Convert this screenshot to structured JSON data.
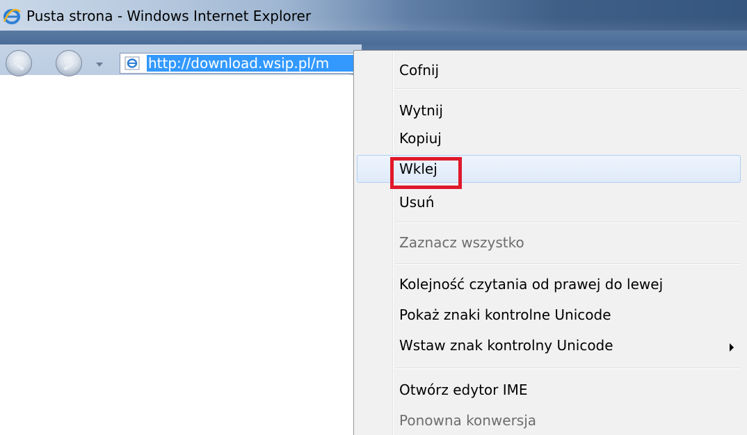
{
  "window": {
    "title": "Pusta strona - Windows Internet Explorer",
    "icon": "ie-icon"
  },
  "navbar": {
    "back_icon": "back-arrow-icon",
    "forward_icon": "forward-arrow-icon",
    "dropdown_icon": "chevron-down-icon",
    "address_value": "http://download.wsip.pl/m",
    "address_icon": "ie-page-icon"
  },
  "context_menu": {
    "items": [
      {
        "label": "Cofnij",
        "enabled": true
      },
      {
        "label": "Wytnij",
        "enabled": true
      },
      {
        "label": "Kopiuj",
        "enabled": true
      },
      {
        "label": "Wklej",
        "enabled": true,
        "hovered": true,
        "highlighted": true
      },
      {
        "label": "Usuń",
        "enabled": true
      },
      {
        "label": "Zaznacz wszystko",
        "enabled": false
      },
      {
        "label": "Kolejność czytania od prawej do lewej",
        "enabled": true
      },
      {
        "label": "Pokaż znaki kontrolne Unicode",
        "enabled": true
      },
      {
        "label": "Wstaw znak kontrolny Unicode",
        "enabled": true,
        "submenu": true
      },
      {
        "label": "Otwórz edytor IME",
        "enabled": true
      },
      {
        "label": "Ponowna konwersja",
        "enabled": false
      }
    ],
    "submenu_icon": "submenu-arrow-icon",
    "highlight_color": "#e0192b"
  }
}
